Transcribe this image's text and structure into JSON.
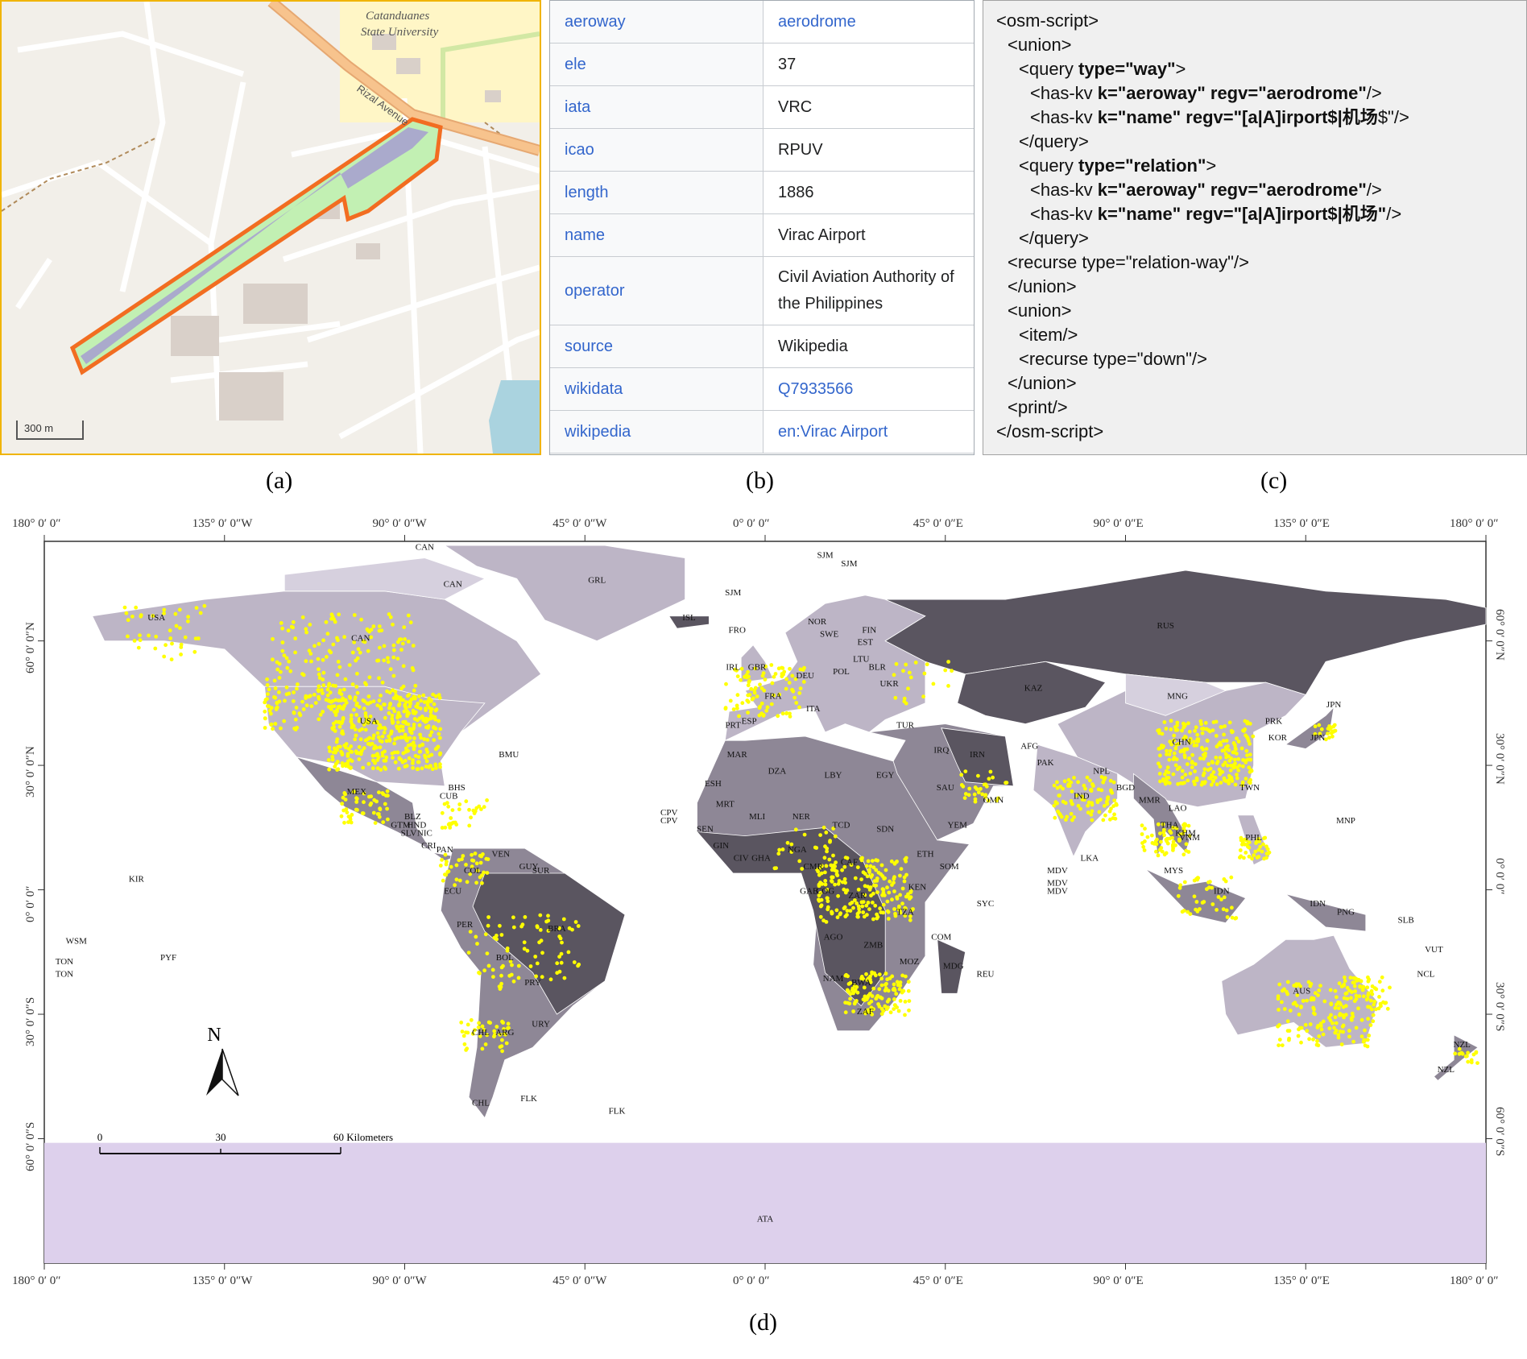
{
  "panel_a": {
    "university_label_1": "Catanduanes",
    "university_label_2": "State University",
    "road_label": "Rizal Avenue",
    "scale_label": "300 m",
    "colors": {
      "boundary": "#f26d21",
      "runway": "#aaaacc",
      "road": "#f7c38d",
      "campus": "#fff6c6"
    }
  },
  "panel_b": {
    "rows": [
      {
        "key": "aeroway",
        "value": "aerodrome",
        "link": true
      },
      {
        "key": "ele",
        "value": "37",
        "link": false
      },
      {
        "key": "iata",
        "value": "VRC",
        "link": false
      },
      {
        "key": "icao",
        "value": "RPUV",
        "link": false
      },
      {
        "key": "length",
        "value": "1886",
        "link": false
      },
      {
        "key": "name",
        "value": "Virac Airport",
        "link": false
      },
      {
        "key": "operator",
        "value": "Civil Aviation Authority of the Philippines",
        "link": false
      },
      {
        "key": "source",
        "value": "Wikipedia",
        "link": false
      },
      {
        "key": "wikidata",
        "value": "Q7933566",
        "link": true
      },
      {
        "key": "wikipedia",
        "value": "en:Virac Airport",
        "link": true
      }
    ]
  },
  "panel_c": {
    "lines": [
      {
        "indent": 0,
        "parts": [
          {
            "t": "<osm-script>",
            "b": false
          }
        ]
      },
      {
        "indent": 1,
        "parts": [
          {
            "t": "<union>",
            "b": false
          }
        ]
      },
      {
        "indent": 2,
        "parts": [
          {
            "t": "<query ",
            "b": false
          },
          {
            "t": "type=\"way\"",
            "b": true
          },
          {
            "t": ">",
            "b": false
          }
        ]
      },
      {
        "indent": 3,
        "parts": [
          {
            "t": "<has-kv ",
            "b": false
          },
          {
            "t": "k=\"aeroway\" regv=\"aerodrome\"",
            "b": true
          },
          {
            "t": "/>",
            "b": false
          }
        ]
      },
      {
        "indent": 3,
        "parts": [
          {
            "t": "<has-kv ",
            "b": false
          },
          {
            "t": "k=\"name\" regv=\"[a|A]irport$|机场",
            "b": true
          },
          {
            "t": "$\"/>",
            "b": false
          }
        ]
      },
      {
        "indent": 2,
        "parts": [
          {
            "t": "</query>",
            "b": false
          }
        ]
      },
      {
        "indent": 2,
        "parts": [
          {
            "t": "<query ",
            "b": false
          },
          {
            "t": "type=\"relation\"",
            "b": true
          },
          {
            "t": ">",
            "b": false
          }
        ]
      },
      {
        "indent": 3,
        "parts": [
          {
            "t": "<has-kv ",
            "b": false
          },
          {
            "t": "k=\"aeroway\" regv=\"aerodrome\"",
            "b": true
          },
          {
            "t": "/>",
            "b": false
          }
        ]
      },
      {
        "indent": 3,
        "parts": [
          {
            "t": "<has-kv ",
            "b": false
          },
          {
            "t": "k=\"name\" regv=\"[a|A]irport$|机场\"",
            "b": true
          },
          {
            "t": "/>",
            "b": false
          }
        ]
      },
      {
        "indent": 2,
        "parts": [
          {
            "t": "</query>",
            "b": false
          }
        ]
      },
      {
        "indent": 1,
        "parts": [
          {
            "t": "<recurse type=\"relation-way\"/>",
            "b": false
          }
        ]
      },
      {
        "indent": 1,
        "parts": [
          {
            "t": "</union>",
            "b": false
          }
        ]
      },
      {
        "indent": 1,
        "parts": [
          {
            "t": "<union>",
            "b": false
          }
        ]
      },
      {
        "indent": 2,
        "parts": [
          {
            "t": "<item/>",
            "b": false
          }
        ]
      },
      {
        "indent": 2,
        "parts": [
          {
            "t": "<recurse type=\"down\"/>",
            "b": false
          }
        ]
      },
      {
        "indent": 1,
        "parts": [
          {
            "t": "</union>",
            "b": false
          }
        ]
      },
      {
        "indent": 1,
        "parts": [
          {
            "t": "<print/>",
            "b": false
          }
        ]
      },
      {
        "indent": 0,
        "parts": [
          {
            "t": "</osm-script>",
            "b": false
          }
        ]
      }
    ]
  },
  "captions": {
    "a": "(a)",
    "b": "(b)",
    "c": "(c)",
    "d": "(d)"
  },
  "panel_d": {
    "lon_labels": [
      "180° 0′ 0″",
      "135° 0′ 0″W",
      "90° 0′ 0″W",
      "45° 0′ 0″W",
      "0° 0′ 0″",
      "45° 0′ 0″E",
      "90° 0′ 0″E",
      "135° 0′ 0″E",
      "180° 0′ 0″"
    ],
    "lat_labels_left": [
      "60° 0′ 0″N",
      "30° 0′ 0″N",
      "0° 0′ 0″",
      "30° 0′ 0″S",
      "60° 0′ 0″S"
    ],
    "lat_labels_right": [
      "60° 0′ 0″N",
      "30° 0′ 0″N",
      "0° 0′ 0″",
      "30° 0′ 0″S",
      "60° 0′ 0″S"
    ],
    "north_arrow": "N",
    "scale": {
      "t0": "0",
      "t1": "30",
      "t2": "60 Kilometers"
    },
    "colors": {
      "airport": "#ffff00",
      "antarctica": "#ddd0ec",
      "dark": "#5a5560",
      "mid": "#8e8796",
      "light": "#bdb5c6",
      "lighter": "#d6d0de"
    },
    "country_labels": [
      {
        "code": "CAN",
        "lon": -101,
        "lat": 60
      },
      {
        "code": "CAN",
        "lon": -78,
        "lat": 73
      },
      {
        "code": "CAN",
        "lon": -85,
        "lat": 82
      },
      {
        "code": "USA",
        "lon": -99,
        "lat": 40
      },
      {
        "code": "USA",
        "lon": -152,
        "lat": 65
      },
      {
        "code": "GRL",
        "lon": -42,
        "lat": 74
      },
      {
        "code": "ISL",
        "lon": -19,
        "lat": 65
      },
      {
        "code": "SJM",
        "lon": 15,
        "lat": 80
      },
      {
        "code": "SJM",
        "lon": 21,
        "lat": 78
      },
      {
        "code": "SJM",
        "lon": -8,
        "lat": 71
      },
      {
        "code": "RUS",
        "lon": 100,
        "lat": 63
      },
      {
        "code": "FIN",
        "lon": 26,
        "lat": 62
      },
      {
        "code": "NOR",
        "lon": 13,
        "lat": 64
      },
      {
        "code": "SWE",
        "lon": 16,
        "lat": 61
      },
      {
        "code": "EST",
        "lon": 25,
        "lat": 59
      },
      {
        "code": "LTU",
        "lon": 24,
        "lat": 55
      },
      {
        "code": "POL",
        "lon": 19,
        "lat": 52
      },
      {
        "code": "DEU",
        "lon": 10,
        "lat": 51
      },
      {
        "code": "FRA",
        "lon": 2,
        "lat": 46
      },
      {
        "code": "GBR",
        "lon": -2,
        "lat": 53
      },
      {
        "code": "IRL",
        "lon": -8,
        "lat": 53
      },
      {
        "code": "ESP",
        "lon": -4,
        "lat": 40
      },
      {
        "code": "PRT",
        "lon": -8,
        "lat": 39
      },
      {
        "code": "ITA",
        "lon": 12,
        "lat": 43
      },
      {
        "code": "UKR",
        "lon": 31,
        "lat": 49
      },
      {
        "code": "BLR",
        "lon": 28,
        "lat": 53
      },
      {
        "code": "TUR",
        "lon": 35,
        "lat": 39
      },
      {
        "code": "KAZ",
        "lon": 67,
        "lat": 48
      },
      {
        "code": "MNG",
        "lon": 103,
        "lat": 46
      },
      {
        "code": "CHN",
        "lon": 104,
        "lat": 35
      },
      {
        "code": "PRK",
        "lon": 127,
        "lat": 40
      },
      {
        "code": "KOR",
        "lon": 128,
        "lat": 36
      },
      {
        "code": "JPN",
        "lon": 138,
        "lat": 36
      },
      {
        "code": "JPN",
        "lon": 142,
        "lat": 44
      },
      {
        "code": "IRN",
        "lon": 53,
        "lat": 32
      },
      {
        "code": "IRQ",
        "lon": 44,
        "lat": 33
      },
      {
        "code": "AFG",
        "lon": 66,
        "lat": 34
      },
      {
        "code": "PAK",
        "lon": 70,
        "lat": 30
      },
      {
        "code": "IND",
        "lon": 79,
        "lat": 22
      },
      {
        "code": "NPL",
        "lon": 84,
        "lat": 28
      },
      {
        "code": "BGD",
        "lon": 90,
        "lat": 24
      },
      {
        "code": "MMR",
        "lon": 96,
        "lat": 21
      },
      {
        "code": "THA",
        "lon": 101,
        "lat": 15
      },
      {
        "code": "LAO",
        "lon": 103,
        "lat": 19
      },
      {
        "code": "VNM",
        "lon": 106,
        "lat": 12
      },
      {
        "code": "KHM",
        "lon": 105,
        "lat": 13
      },
      {
        "code": "MYS",
        "lon": 102,
        "lat": 4
      },
      {
        "code": "IDN",
        "lon": 114,
        "lat": -1
      },
      {
        "code": "IDN",
        "lon": 138,
        "lat": -4
      },
      {
        "code": "PHL",
        "lon": 122,
        "lat": 12
      },
      {
        "code": "TWN",
        "lon": 121,
        "lat": 24
      },
      {
        "code": "PNG",
        "lon": 145,
        "lat": -6
      },
      {
        "code": "SLB",
        "lon": 160,
        "lat": -8
      },
      {
        "code": "AUS",
        "lon": 134,
        "lat": -25
      },
      {
        "code": "NZL",
        "lon": 174,
        "lat": -38
      },
      {
        "code": "NZL",
        "lon": 170,
        "lat": -44
      },
      {
        "code": "NCL",
        "lon": 165,
        "lat": -21
      },
      {
        "code": "VUT",
        "lon": 167,
        "lat": -15
      },
      {
        "code": "MNP",
        "lon": 145,
        "lat": 16
      },
      {
        "code": "SAU",
        "lon": 45,
        "lat": 24
      },
      {
        "code": "YEM",
        "lon": 48,
        "lat": 15
      },
      {
        "code": "OMN",
        "lon": 57,
        "lat": 21
      },
      {
        "code": "EGY",
        "lon": 30,
        "lat": 27
      },
      {
        "code": "LBY",
        "lon": 17,
        "lat": 27
      },
      {
        "code": "DZA",
        "lon": 3,
        "lat": 28
      },
      {
        "code": "MAR",
        "lon": -7,
        "lat": 32
      },
      {
        "code": "MRT",
        "lon": -10,
        "lat": 20
      },
      {
        "code": "MLI",
        "lon": -2,
        "lat": 17
      },
      {
        "code": "NER",
        "lon": 9,
        "lat": 17
      },
      {
        "code": "TCD",
        "lon": 19,
        "lat": 15
      },
      {
        "code": "SDN",
        "lon": 30,
        "lat": 14
      },
      {
        "code": "ETH",
        "lon": 40,
        "lat": 8
      },
      {
        "code": "SOM",
        "lon": 46,
        "lat": 5
      },
      {
        "code": "KEN",
        "lon": 38,
        "lat": 0
      },
      {
        "code": "NGA",
        "lon": 8,
        "lat": 9
      },
      {
        "code": "CAF",
        "lon": 21,
        "lat": 6
      },
      {
        "code": "ZAR",
        "lon": 23,
        "lat": -2
      },
      {
        "code": "TZA",
        "lon": 35,
        "lat": -6
      },
      {
        "code": "AGO",
        "lon": 17,
        "lat": -12
      },
      {
        "code": "ZMB",
        "lon": 27,
        "lat": -14
      },
      {
        "code": "MOZ",
        "lon": 36,
        "lat": -18
      },
      {
        "code": "NAM",
        "lon": 17,
        "lat": -22
      },
      {
        "code": "BWA",
        "lon": 24,
        "lat": -23
      },
      {
        "code": "ZAF",
        "lon": 25,
        "lat": -30
      },
      {
        "code": "MDG",
        "lon": 47,
        "lat": -19
      },
      {
        "code": "REU",
        "lon": 55,
        "lat": -21
      },
      {
        "code": "SYC",
        "lon": 55,
        "lat": -4
      },
      {
        "code": "COM",
        "lon": 44,
        "lat": -12
      },
      {
        "code": "SEN",
        "lon": -15,
        "lat": 14
      },
      {
        "code": "GIN",
        "lon": -11,
        "lat": 10
      },
      {
        "code": "CIV",
        "lon": -6,
        "lat": 7
      },
      {
        "code": "GHA",
        "lon": -1,
        "lat": 7
      },
      {
        "code": "CMR",
        "lon": 12,
        "lat": 5
      },
      {
        "code": "GAB",
        "lon": 11,
        "lat": -1
      },
      {
        "code": "COG",
        "lon": 15,
        "lat": -1
      },
      {
        "code": "ESH",
        "lon": -13,
        "lat": 25
      },
      {
        "code": "CPV",
        "lon": -24,
        "lat": 16
      },
      {
        "code": "CPV",
        "lon": -24,
        "lat": 18
      },
      {
        "code": "FRO",
        "lon": -7,
        "lat": 62
      },
      {
        "code": "MEX",
        "lon": -102,
        "lat": 23
      },
      {
        "code": "CUB",
        "lon": -79,
        "lat": 22
      },
      {
        "code": "BHS",
        "lon": -77,
        "lat": 24
      },
      {
        "code": "BMU",
        "lon": -64,
        "lat": 32
      },
      {
        "code": "BLZ",
        "lon": -88,
        "lat": 17
      },
      {
        "code": "GTM",
        "lon": -91,
        "lat": 15
      },
      {
        "code": "HND",
        "lon": -87,
        "lat": 15
      },
      {
        "code": "SLV",
        "lon": -89,
        "lat": 13
      },
      {
        "code": "NIC",
        "lon": -85,
        "lat": 13
      },
      {
        "code": "CRI",
        "lon": -84,
        "lat": 10
      },
      {
        "code": "PAN",
        "lon": -80,
        "lat": 9
      },
      {
        "code": "COL",
        "lon": -73,
        "lat": 4
      },
      {
        "code": "VEN",
        "lon": -66,
        "lat": 8
      },
      {
        "code": "GUY",
        "lon": -59,
        "lat": 5
      },
      {
        "code": "SUR",
        "lon": -56,
        "lat": 4
      },
      {
        "code": "ECU",
        "lon": -78,
        "lat": -1
      },
      {
        "code": "PER",
        "lon": -75,
        "lat": -9
      },
      {
        "code": "BRA",
        "lon": -52,
        "lat": -10
      },
      {
        "code": "BOL",
        "lon": -65,
        "lat": -17
      },
      {
        "code": "PRY",
        "lon": -58,
        "lat": -23
      },
      {
        "code": "URY",
        "lon": -56,
        "lat": -33
      },
      {
        "code": "ARG",
        "lon": -65,
        "lat": -35
      },
      {
        "code": "CHL",
        "lon": -71,
        "lat": -35
      },
      {
        "code": "CHL",
        "lon": -71,
        "lat": -52
      },
      {
        "code": "FLK",
        "lon": -59,
        "lat": -51
      },
      {
        "code": "FLK",
        "lon": -37,
        "lat": -54
      },
      {
        "code": "KIR",
        "lon": -157,
        "lat": 2
      },
      {
        "code": "WSM",
        "lon": -172,
        "lat": -13
      },
      {
        "code": "TON",
        "lon": -175,
        "lat": -18
      },
      {
        "code": "TON",
        "lon": -175,
        "lat": -21
      },
      {
        "code": "PYF",
        "lon": -149,
        "lat": -17
      },
      {
        "code": "LKA",
        "lon": 81,
        "lat": 7
      },
      {
        "code": "MDV",
        "lon": 73,
        "lat": 4
      },
      {
        "code": "MDV",
        "lon": 73,
        "lat": 1
      },
      {
        "code": "MDV",
        "lon": 73,
        "lat": -1
      },
      {
        "code": "ATA",
        "lon": 0,
        "lat": -80
      }
    ]
  }
}
